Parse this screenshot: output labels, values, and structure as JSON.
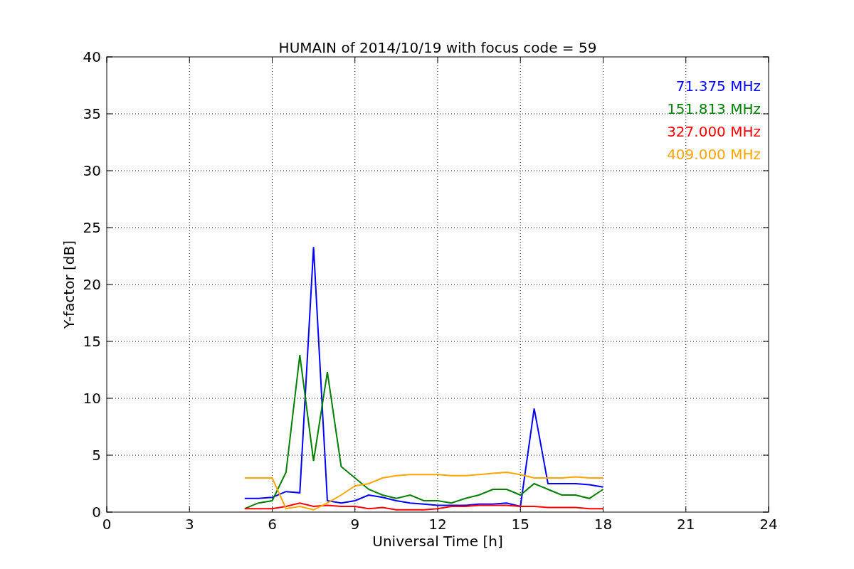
{
  "figure": {
    "chart_data": {
      "type": "line",
      "title": "HUMAIN of 2014/10/19 with focus code = 59",
      "xlabel": "Universal Time [h]",
      "ylabel": "Y-factor [dB]",
      "x": [
        5,
        5.5,
        6,
        6.5,
        7,
        7.5,
        8,
        8.5,
        9,
        9.5,
        10,
        10.5,
        11,
        11.5,
        12,
        12.5,
        13,
        13.5,
        14,
        14.5,
        15,
        15.5,
        16,
        16.5,
        17,
        17.5,
        18
      ],
      "series": [
        {
          "name": "71.375 MHz",
          "color": "#0000ff",
          "values": [
            1.2,
            1.2,
            1.3,
            1.8,
            1.7,
            23.3,
            1.0,
            0.8,
            1.0,
            1.5,
            1.3,
            1.0,
            0.8,
            0.7,
            0.6,
            0.6,
            0.6,
            0.7,
            0.7,
            0.8,
            0.5,
            9.1,
            2.5,
            2.5,
            2.5,
            2.4,
            2.2
          ]
        },
        {
          "name": "151.813 MHz",
          "color": "#008000",
          "values": [
            0.3,
            0.8,
            1.0,
            3.5,
            13.8,
            4.5,
            12.3,
            4.0,
            3.0,
            2.0,
            1.5,
            1.2,
            1.5,
            1.0,
            1.0,
            0.8,
            1.2,
            1.5,
            2.0,
            2.0,
            1.5,
            2.5,
            2.0,
            1.5,
            1.5,
            1.2,
            2.0
          ]
        },
        {
          "name": "327.000 MHz",
          "color": "#ff0000",
          "values": [
            0.3,
            0.3,
            0.3,
            0.5,
            0.8,
            0.5,
            0.6,
            0.5,
            0.5,
            0.3,
            0.4,
            0.2,
            0.2,
            0.2,
            0.3,
            0.5,
            0.5,
            0.6,
            0.6,
            0.6,
            0.5,
            0.5,
            0.4,
            0.4,
            0.4,
            0.3,
            0.3
          ]
        },
        {
          "name": "409.000 MHz",
          "color": "#ffa500",
          "values": [
            3.0,
            3.0,
            3.0,
            0.3,
            0.5,
            0.2,
            0.8,
            1.5,
            2.3,
            2.5,
            3.0,
            3.2,
            3.3,
            3.3,
            3.3,
            3.2,
            3.2,
            3.3,
            3.4,
            3.5,
            3.3,
            3.0,
            3.0,
            3.0,
            3.1,
            3.0,
            3.0
          ]
        }
      ],
      "grid": true,
      "xlim": [
        0,
        24
      ],
      "ylim": [
        0,
        40
      ],
      "xticks": [
        0,
        3,
        6,
        9,
        12,
        15,
        18,
        21,
        24
      ],
      "yticks": [
        0,
        5,
        10,
        15,
        20,
        25,
        30,
        35,
        40
      ]
    }
  }
}
